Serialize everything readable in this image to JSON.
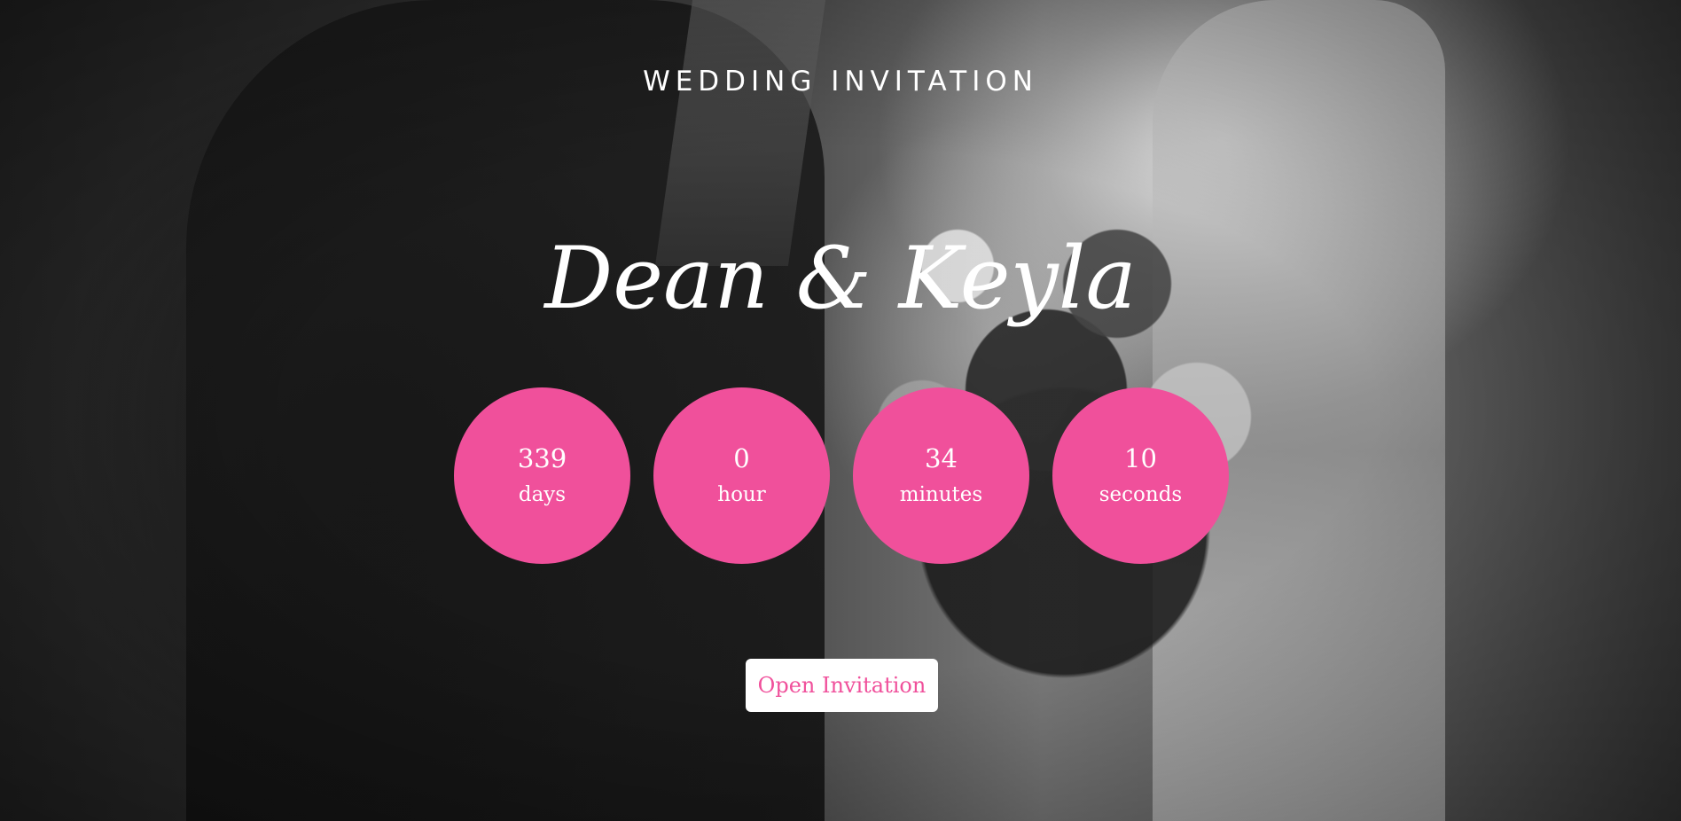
{
  "header": {
    "subtitle": "WEDDING INVITATION"
  },
  "couple": {
    "names": "Dean & Keyla"
  },
  "countdown": [
    {
      "value": "339",
      "unit": "days"
    },
    {
      "value": "0",
      "unit": "hour"
    },
    {
      "value": "34",
      "unit": "minutes"
    },
    {
      "value": "10",
      "unit": "seconds"
    }
  ],
  "cta": {
    "label": "Open Invitation"
  },
  "colors": {
    "accent": "#f0509b",
    "text": "#ffffff",
    "button_bg": "#ffffff"
  }
}
